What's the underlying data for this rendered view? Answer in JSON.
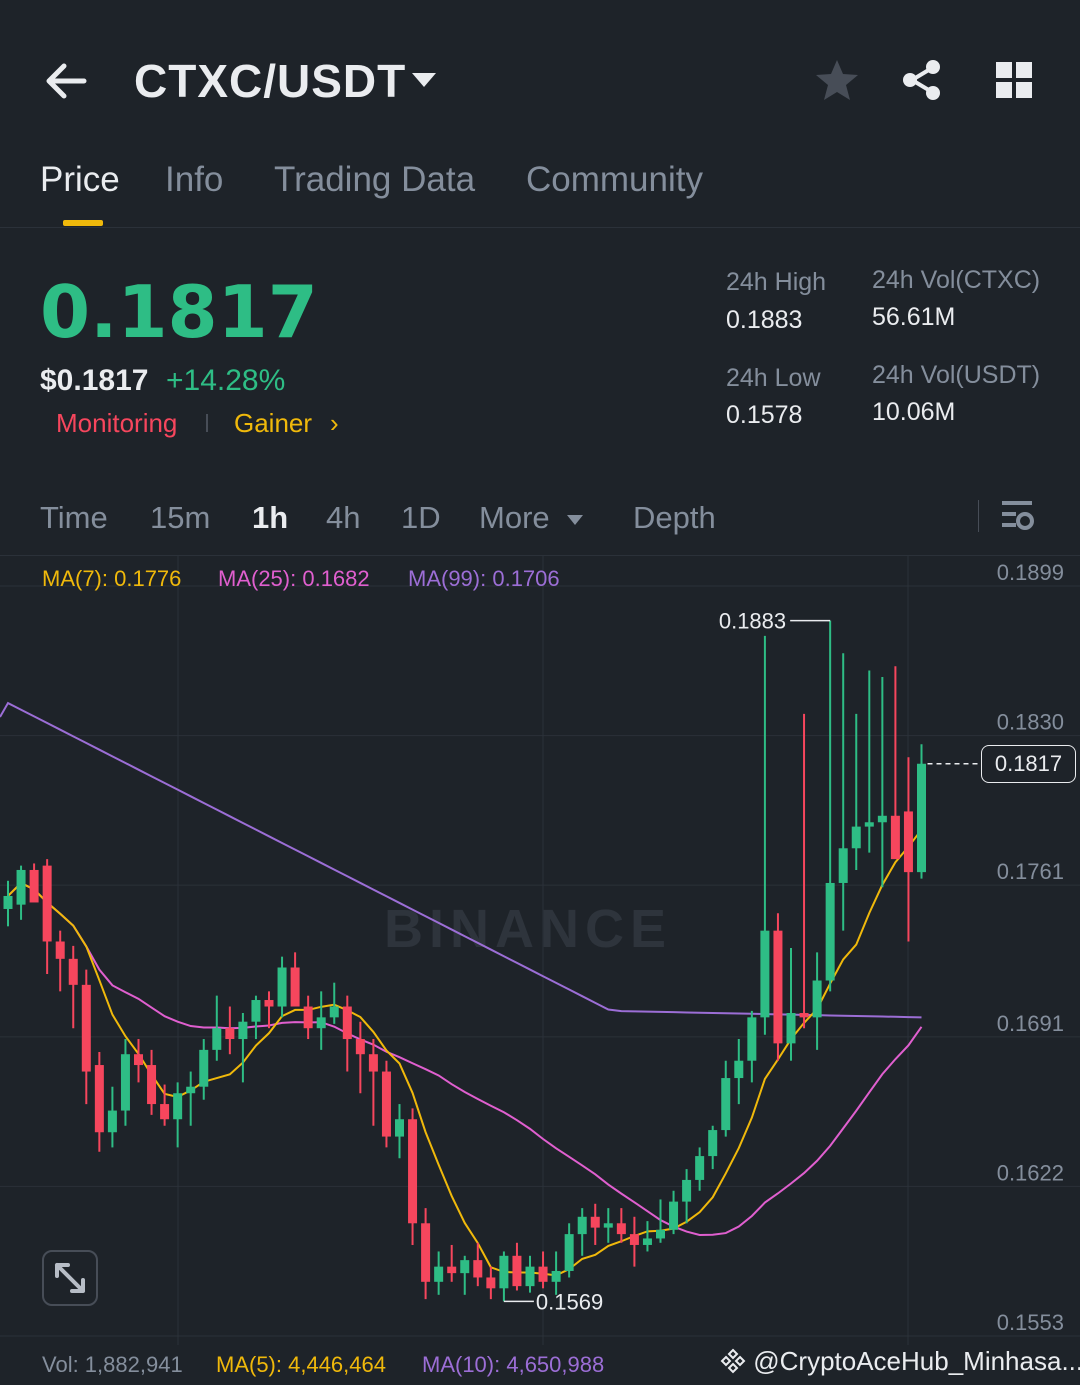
{
  "header": {
    "pair": "CTXC/USDT"
  },
  "tabs": [
    {
      "label": "Price",
      "active": true
    },
    {
      "label": "Info",
      "active": false
    },
    {
      "label": "Trading Data",
      "active": false
    },
    {
      "label": "Community",
      "active": false
    }
  ],
  "price": {
    "last": "0.1817",
    "usd": "$0.1817",
    "change": "+14.28%",
    "tag_monitoring": "Monitoring",
    "tag_gainer": "Gainer",
    "tag_chevron": "›"
  },
  "stats": {
    "high_label": "24h High",
    "high_value": "0.1883",
    "low_label": "24h Low",
    "low_value": "0.1578",
    "vol_base_label": "24h Vol(CTXC)",
    "vol_base_value": "56.61M",
    "vol_quote_label": "24h Vol(USDT)",
    "vol_quote_value": "10.06M"
  },
  "intervals": {
    "time": "Time",
    "m15": "15m",
    "h1": "1h",
    "h4": "4h",
    "d1": "1D",
    "more": "More",
    "depth": "Depth",
    "active": "1h"
  },
  "ma_legend": {
    "ma7": "MA(7): 0.1776",
    "ma25": "MA(25): 0.1682",
    "ma99": "MA(99): 0.1706"
  },
  "volume_legend": {
    "vol": "Vol: 1,882,941",
    "ma5": "MA(5): 4,446,464",
    "ma10": "MA(10): 4,650,988"
  },
  "watermark": {
    "brand": "BINANCE",
    "handle": "@CryptoAceHub_Minhasa..."
  },
  "colors": {
    "up": "#2ebd85",
    "down": "#f6465d",
    "accent": "#f0b90b",
    "ma7": "#f0b90b",
    "ma25": "#e05fcf",
    "ma99": "#9c6ed6",
    "background": "#1e2329"
  },
  "icons": {
    "back": "arrow-left-icon",
    "caret": "caret-down-icon",
    "star": "star-icon",
    "share": "share-icon",
    "grid": "grid-icon",
    "settings": "chart-settings-icon",
    "expand": "expand-icon"
  },
  "chart_data": {
    "type": "candlestick",
    "interval": "1h",
    "y_ticks": [
      "0.1899",
      "0.1830",
      "0.1761",
      "0.1691",
      "0.1622",
      "0.1553"
    ],
    "ylim": [
      0.1553,
      0.1899
    ],
    "current_price": "0.1817",
    "high_annotation": "0.1883",
    "low_annotation": "0.1569",
    "candles": [
      [
        0.175,
        0.1763,
        0.1742,
        0.1756
      ],
      [
        0.1752,
        0.177,
        0.1745,
        0.1768
      ],
      [
        0.1768,
        0.1771,
        0.176,
        0.1753
      ],
      [
        0.177,
        0.1773,
        0.172,
        0.1735
      ],
      [
        0.1735,
        0.174,
        0.1712,
        0.1727
      ],
      [
        0.1727,
        0.1733,
        0.1695,
        0.1715
      ],
      [
        0.1715,
        0.1722,
        0.166,
        0.1675
      ],
      [
        0.1678,
        0.1684,
        0.1638,
        0.1647
      ],
      [
        0.1647,
        0.1668,
        0.164,
        0.1657
      ],
      [
        0.1657,
        0.169,
        0.165,
        0.1683
      ],
      [
        0.1683,
        0.169,
        0.167,
        0.1678
      ],
      [
        0.1678,
        0.1685,
        0.1655,
        0.166
      ],
      [
        0.166,
        0.1669,
        0.165,
        0.1653
      ],
      [
        0.1653,
        0.167,
        0.164,
        0.1665
      ],
      [
        0.1665,
        0.1675,
        0.165,
        0.1668
      ],
      [
        0.1668,
        0.169,
        0.1662,
        0.1685
      ],
      [
        0.1685,
        0.171,
        0.168,
        0.1695
      ],
      [
        0.1695,
        0.1705,
        0.1683,
        0.169
      ],
      [
        0.169,
        0.1702,
        0.167,
        0.1698
      ],
      [
        0.1698,
        0.171,
        0.169,
        0.1708
      ],
      [
        0.1708,
        0.1712,
        0.1695,
        0.1705
      ],
      [
        0.1705,
        0.1728,
        0.17,
        0.1723
      ],
      [
        0.1723,
        0.173,
        0.1712,
        0.1705
      ],
      [
        0.1705,
        0.171,
        0.169,
        0.1695
      ],
      [
        0.1695,
        0.1712,
        0.1685,
        0.17
      ],
      [
        0.17,
        0.1716,
        0.1697,
        0.1705
      ],
      [
        0.1705,
        0.171,
        0.1675,
        0.169
      ],
      [
        0.169,
        0.1698,
        0.1665,
        0.1683
      ],
      [
        0.1683,
        0.169,
        0.165,
        0.1675
      ],
      [
        0.1675,
        0.168,
        0.164,
        0.1645
      ],
      [
        0.1645,
        0.166,
        0.1635,
        0.1653
      ],
      [
        0.1653,
        0.1658,
        0.1595,
        0.1605
      ],
      [
        0.1605,
        0.1612,
        0.157,
        0.1578
      ],
      [
        0.1578,
        0.1592,
        0.1572,
        0.1585
      ],
      [
        0.1585,
        0.1595,
        0.1578,
        0.1582
      ],
      [
        0.1582,
        0.159,
        0.1572,
        0.1588
      ],
      [
        0.1588,
        0.1596,
        0.1576,
        0.158
      ],
      [
        0.158,
        0.1585,
        0.157,
        0.1575
      ],
      [
        0.1575,
        0.1592,
        0.1569,
        0.159
      ],
      [
        0.159,
        0.1596,
        0.1574,
        0.1576
      ],
      [
        0.1576,
        0.159,
        0.1573,
        0.1585
      ],
      [
        0.1585,
        0.1592,
        0.1575,
        0.1578
      ],
      [
        0.1578,
        0.1592,
        0.1572,
        0.1583
      ],
      [
        0.1583,
        0.1605,
        0.158,
        0.16
      ],
      [
        0.16,
        0.1612,
        0.159,
        0.1608
      ],
      [
        0.1608,
        0.1614,
        0.1595,
        0.1603
      ],
      [
        0.1603,
        0.1612,
        0.1596,
        0.1605
      ],
      [
        0.1605,
        0.1612,
        0.1596,
        0.16
      ],
      [
        0.16,
        0.1608,
        0.1585,
        0.1595
      ],
      [
        0.1595,
        0.1606,
        0.1592,
        0.1598
      ],
      [
        0.1598,
        0.1616,
        0.1596,
        0.1602
      ],
      [
        0.1602,
        0.162,
        0.16,
        0.1615
      ],
      [
        0.1615,
        0.163,
        0.1605,
        0.1625
      ],
      [
        0.1625,
        0.164,
        0.162,
        0.1636
      ],
      [
        0.1636,
        0.165,
        0.163,
        0.1648
      ],
      [
        0.1648,
        0.168,
        0.1645,
        0.1672
      ],
      [
        0.1672,
        0.169,
        0.166,
        0.168
      ],
      [
        0.168,
        0.1703,
        0.167,
        0.17
      ],
      [
        0.17,
        0.1876,
        0.1692,
        0.174
      ],
      [
        0.174,
        0.1748,
        0.168,
        0.1688
      ],
      [
        0.1688,
        0.1732,
        0.168,
        0.1702
      ],
      [
        0.1702,
        0.184,
        0.1695,
        0.17
      ],
      [
        0.17,
        0.173,
        0.1685,
        0.1717
      ],
      [
        0.1717,
        0.1883,
        0.1712,
        0.1762
      ],
      [
        0.1762,
        0.1868,
        0.174,
        0.1778
      ],
      [
        0.1778,
        0.184,
        0.1768,
        0.1788
      ],
      [
        0.1788,
        0.186,
        0.1776,
        0.179
      ],
      [
        0.179,
        0.1857,
        0.176,
        0.1793
      ],
      [
        0.1793,
        0.1862,
        0.1775,
        0.1773
      ],
      [
        0.1795,
        0.182,
        0.1735,
        0.1767
      ],
      [
        0.1767,
        0.1826,
        0.1764,
        0.1817
      ]
    ]
  }
}
